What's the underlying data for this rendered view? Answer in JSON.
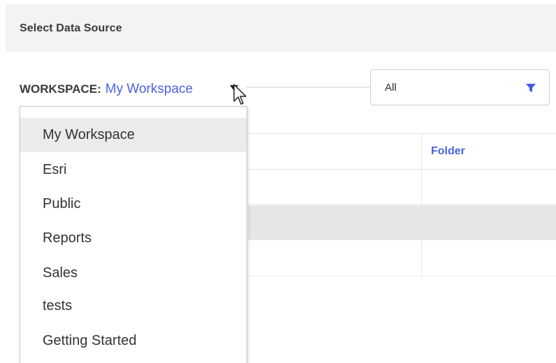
{
  "header": {
    "title": "Select Data Source"
  },
  "workspace": {
    "label": "WORKSPACE:",
    "value": "My Workspace",
    "caret_icon": "caret-down-icon"
  },
  "filter": {
    "value": "All",
    "icon": "filter-icon",
    "icon_color": "#3f5ee8"
  },
  "table": {
    "columns": [
      "",
      "Folder"
    ],
    "rows": [
      {
        "selected": false
      },
      {
        "selected": true
      },
      {
        "selected": false
      }
    ]
  },
  "dropdown": {
    "items": [
      {
        "label": "My Workspace",
        "active": true
      },
      {
        "label": "Esri",
        "active": false
      },
      {
        "label": "Public",
        "active": false
      },
      {
        "label": "Reports",
        "active": false
      },
      {
        "label": "Sales",
        "active": false
      },
      {
        "label": "tests",
        "active": false
      },
      {
        "label": "Getting Started",
        "active": false
      }
    ]
  },
  "colors": {
    "accent": "#4a64e0",
    "header_bg": "#f3f3f3",
    "selected_row": "#e6e6e6"
  }
}
